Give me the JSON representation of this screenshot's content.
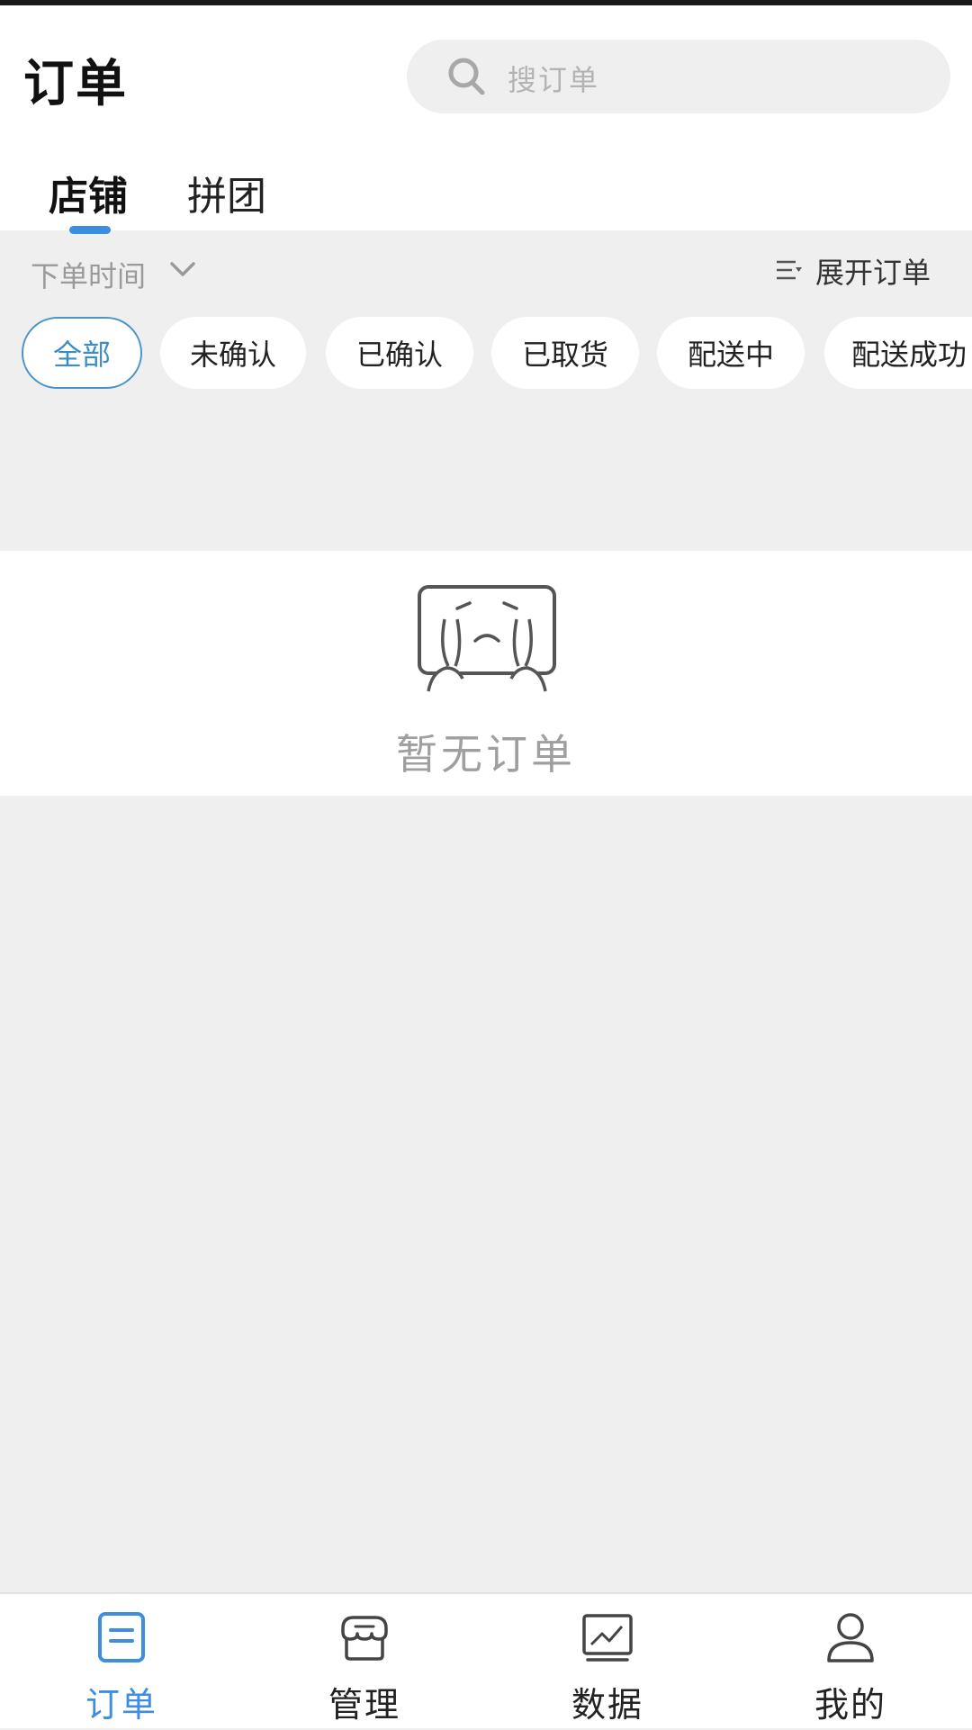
{
  "header": {
    "title": "订单",
    "search_placeholder": "搜订单",
    "tabs": [
      {
        "label": "店铺",
        "active": true
      },
      {
        "label": "拼团",
        "active": false
      }
    ]
  },
  "filters": {
    "sort_label": "下单时间",
    "expand_label": "展开订单",
    "statuses": [
      {
        "label": "全部",
        "active": true
      },
      {
        "label": "未确认",
        "active": false
      },
      {
        "label": "已确认",
        "active": false
      },
      {
        "label": "已取货",
        "active": false
      },
      {
        "label": "配送中",
        "active": false
      },
      {
        "label": "配送成功",
        "active": false
      }
    ]
  },
  "empty_state": {
    "icon": "crying-face-icon",
    "message": "暂无订单"
  },
  "tabbar": {
    "items": [
      {
        "label": "订单",
        "icon": "order-icon",
        "active": true
      },
      {
        "label": "管理",
        "icon": "store-icon",
        "active": false
      },
      {
        "label": "数据",
        "icon": "chart-icon",
        "active": false
      },
      {
        "label": "我的",
        "icon": "user-icon",
        "active": false
      }
    ]
  },
  "colors": {
    "accent": "#3d8ee2",
    "background": "#efefef",
    "surface": "#ffffff",
    "muted_text": "#9f9f9f"
  }
}
